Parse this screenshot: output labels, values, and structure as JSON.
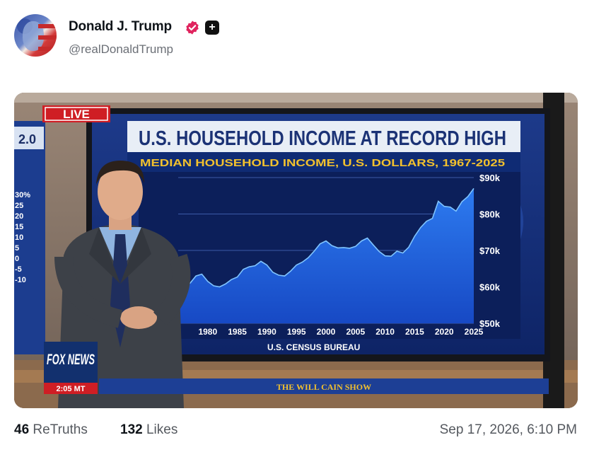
{
  "post": {
    "author_name": "Donald J. Trump",
    "handle": "@realDonaldTrump",
    "verified_icon": "verified-badge-icon",
    "plus_badge": "+",
    "retruths_count": "46",
    "retruths_label": "ReTruths",
    "likes_count": "132",
    "likes_label": "Likes",
    "timestamp": "Sep 17, 2026, 6:10 PM"
  },
  "colors": {
    "verified": "#e0245e",
    "chart_fill": "#1e63e0",
    "chart_bg": "#15285e",
    "title_yellow": "#f2c12e"
  },
  "media": {
    "live_tag": "LIVE",
    "side_screen_header": "2.0",
    "side_screen_ticks": [
      "30%",
      "25",
      "20",
      "15",
      "10",
      "5",
      "0",
      "-5",
      "-10"
    ],
    "network_logo": "FOX NEWS",
    "time_bug": "2:05 MT",
    "show_banner": "THE WILL CAIN SHOW",
    "chart_data": {
      "type": "area",
      "title": "U.S. HOUSEHOLD INCOME AT RECORD HIGH",
      "subtitle": "MEDIAN HOUSEHOLD INCOME, U.S. DOLLARS, 1967-2025",
      "source": "U.S. CENSUS BUREAU",
      "xlim": [
        1975,
        2025
      ],
      "ylim": [
        50000,
        90000
      ],
      "x_ticks": [
        "1980",
        "1985",
        "1990",
        "1995",
        "2000",
        "2005",
        "2010",
        "2015",
        "2020",
        "2025"
      ],
      "y_ticks": [
        "$50k",
        "$60k",
        "$70k",
        "$80k",
        "$90k"
      ],
      "y_tick_values": [
        50000,
        60000,
        70000,
        80000,
        90000
      ],
      "grid": true,
      "x": [
        1975,
        1976,
        1977,
        1978,
        1979,
        1980,
        1981,
        1982,
        1983,
        1984,
        1985,
        1986,
        1987,
        1988,
        1989,
        1990,
        1991,
        1992,
        1993,
        1994,
        1995,
        1996,
        1997,
        1998,
        1999,
        2000,
        2001,
        2002,
        2003,
        2004,
        2005,
        2006,
        2007,
        2008,
        2009,
        2010,
        2011,
        2012,
        2013,
        2014,
        2015,
        2016,
        2017,
        2018,
        2019,
        2020,
        2021,
        2022,
        2023,
        2024,
        2025
      ],
      "y": [
        60000,
        61000,
        61000,
        63000,
        63500,
        61500,
        60300,
        60000,
        60800,
        62000,
        62700,
        64800,
        65500,
        65800,
        67000,
        66000,
        64000,
        63200,
        63000,
        64300,
        66000,
        66800,
        68000,
        69800,
        71800,
        72600,
        71300,
        70700,
        70800,
        70600,
        71100,
        72600,
        73400,
        71500,
        69700,
        68500,
        68400,
        69800,
        69300,
        70900,
        73900,
        76300,
        78000,
        78800,
        83500,
        82100,
        81900,
        80800,
        83400,
        84800,
        87000
      ]
    }
  }
}
